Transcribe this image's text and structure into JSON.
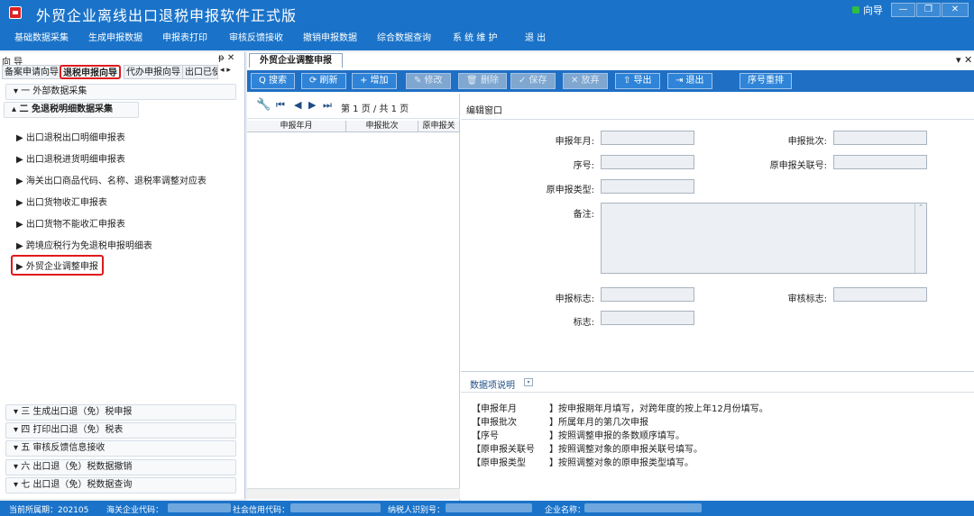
{
  "window": {
    "title": "外贸企业离线出口退税申报软件正式版",
    "guide_label": "向导",
    "min": "—",
    "max": "❐",
    "close": "✕"
  },
  "menu": [
    "基础数据采集",
    "生成申报数据",
    "申报表打印",
    "审核反馈接收",
    "撤销申报数据",
    "综合数据查询",
    "系 统 维 护",
    "退 出"
  ],
  "left_panel": {
    "title": "向 导",
    "pin": "ᵽ ✕",
    "tabs": [
      "备案申请向导",
      "退税申报向导",
      "代办申报向导",
      "出口已使"
    ],
    "tab_arrows": "◂ ▸",
    "sections_top": [
      {
        "label": "▾ 一  外部数据采集"
      },
      {
        "label": "▴ 二  免退税明细数据采集"
      }
    ],
    "leaves": [
      "出口退税出口明细申报表",
      "出口退税进货明细申报表",
      "海关出口商品代码、名称、退税率调整对应表",
      "出口货物收汇申报表",
      "出口货物不能收汇申报表",
      "跨境应税行为免退税申报明细表",
      "外贸企业调整申报"
    ],
    "sections_bottom": [
      "▾ 三  生成出口退（免）税申报",
      "▾ 四  打印出口退（免）税表",
      "▾ 五  审核反馈信息接收",
      "▾ 六  出口退（免）税数据撤销",
      "▾ 七  出口退（免）税数据查询"
    ]
  },
  "document": {
    "tab": "外贸企业调整申报",
    "close": "▾ ✕"
  },
  "toolbar": [
    "Q 搜索",
    "⟳ 刷新",
    "+ 增加",
    "✎ 修改",
    "🗑 删除",
    "✓ 保存",
    "✕ 放弃",
    "⇧ 导出",
    "⇥ 退出",
    "序号重排"
  ],
  "grid": {
    "page_info": "第 1 页 / 共 1 页",
    "columns": [
      "申报年月",
      "申报批次",
      "原申报关"
    ]
  },
  "form": {
    "title": "编辑窗口",
    "labels": {
      "year_month": "申报年月:",
      "batch": "申报批次:",
      "seq": "序号:",
      "orig_link": "原申报关联号:",
      "orig_type": "原申报类型:",
      "remark": "备注:",
      "decl_flag": "申报标志:",
      "audit_flag": "审核标志:",
      "flag": "标志:"
    }
  },
  "desc": {
    "title": "数据项说明",
    "rows": [
      {
        "k": "【申报年月",
        "v": "】按申报期年月填写，对跨年度的按上年12月份填写。"
      },
      {
        "k": "【申报批次",
        "v": "】所属年月的第几次申报"
      },
      {
        "k": "【序号",
        "v": "】按照调整申报的条数顺序填写。"
      },
      {
        "k": "【原申报关联号",
        "v": "】按照调整对象的原申报关联号填写。"
      },
      {
        "k": "【原申报类型",
        "v": "】按照调整对象的原申报类型填写。"
      }
    ]
  },
  "status": {
    "period": "当前所属期：202105",
    "customs": "海关企业代码：",
    "credit": "社会信用代码：",
    "taxid": "纳税人识别号：",
    "company": "企业名称："
  },
  "colors": {
    "accent": "#1a73c9",
    "highlight": "#e0191c"
  }
}
